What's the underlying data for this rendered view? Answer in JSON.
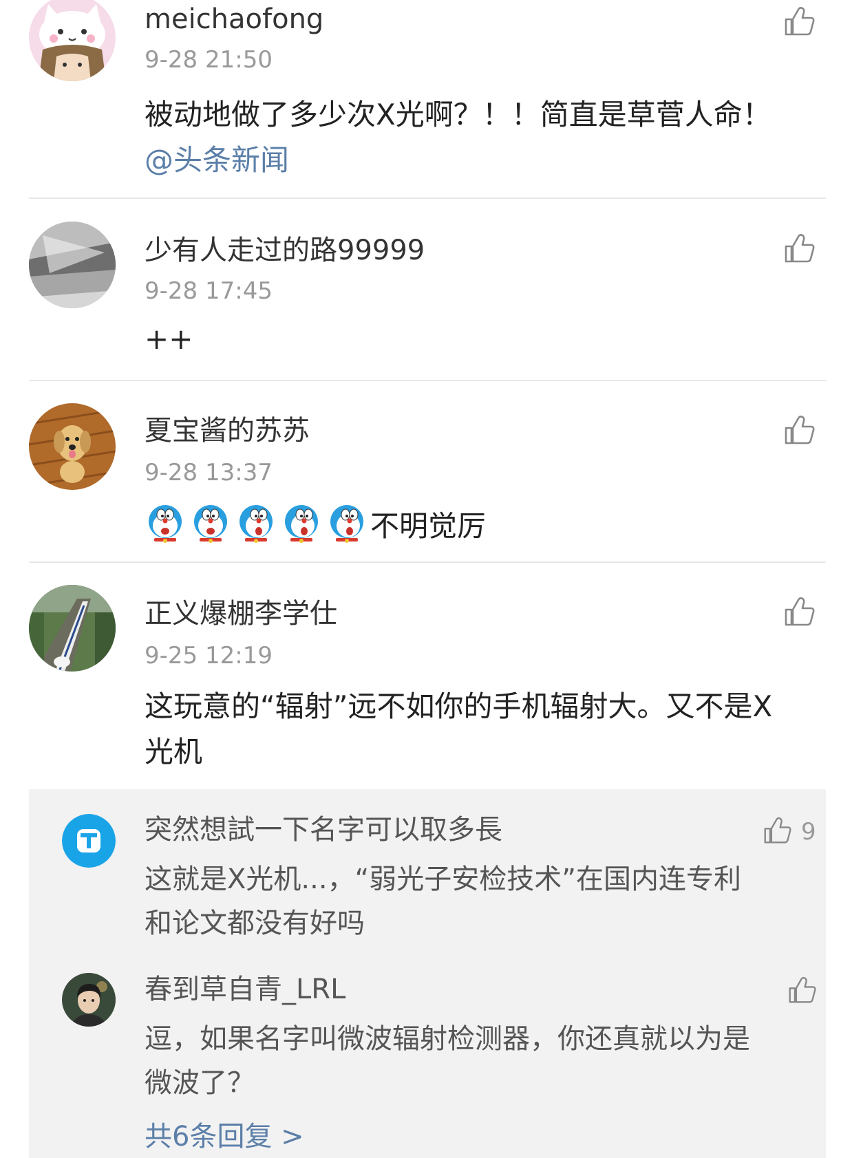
{
  "comments": [
    {
      "username": "meichaofong",
      "time": "9-28 21:50",
      "text": "被动地做了多少次X光啊？！！简直是草菅人命！",
      "mention": "@头条新闻",
      "avatar_icon": "cartoon-cat-girl-avatar"
    },
    {
      "username": "少有人走过的路99999",
      "time": "9-28 17:45",
      "text": "++",
      "avatar_icon": "gray-geometric-avatar"
    },
    {
      "username": "夏宝酱的苏苏",
      "time": "9-28 13:37",
      "emoji_count": 5,
      "emoji_icon": "doraemon-face-emoji",
      "text": "不明觉厉",
      "avatar_icon": "golden-retriever-dog-avatar"
    },
    {
      "username": "正义爆棚李学仕",
      "time": "9-25 12:19",
      "text_line1": "这玩意的“辐射”远不如你的手机辐射大。又不是X",
      "text_line2": "光机",
      "avatar_icon": "high-speed-train-avatar",
      "replies": [
        {
          "username": "突然想試一下名字可以取多長",
          "likes": "9",
          "text_line1": "这就是X光机...，“弱光子安检技术”在国内连专利",
          "text_line2": "和论文都没有好吗",
          "avatar_icon": "letter-t-blue-avatar"
        },
        {
          "username": "春到草自青_LRL",
          "text_line1": "逗，如果名字叫微波辐射检测器，你还真就以为是",
          "text_line2": "微波了？",
          "avatar_icon": "young-man-photo-avatar"
        }
      ],
      "more_replies": "共6条回复 >"
    }
  ],
  "colors": {
    "link": "#5b7fa8",
    "timestamp": "#999999",
    "reply_background": "#f2f2f2",
    "divider": "#e8e8e8"
  }
}
